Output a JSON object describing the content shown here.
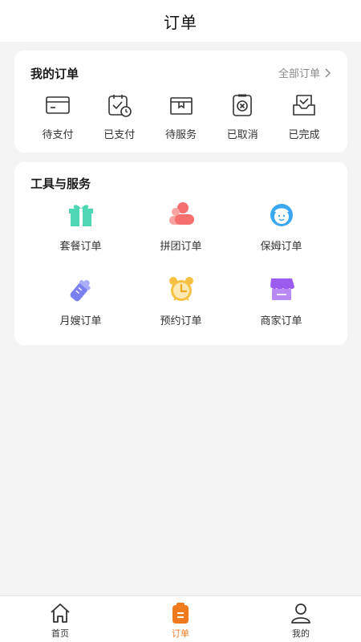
{
  "header": {
    "title": "订单"
  },
  "my_orders": {
    "title": "我的订单",
    "all_link": "全部订单",
    "items": [
      {
        "label": "待支付",
        "icon": "card-icon"
      },
      {
        "label": "已支付",
        "icon": "paid-clock-icon"
      },
      {
        "label": "待服务",
        "icon": "box-icon"
      },
      {
        "label": "已取消",
        "icon": "cancel-icon"
      },
      {
        "label": "已完成",
        "icon": "done-tray-icon"
      }
    ]
  },
  "tools": {
    "title": "工具与服务",
    "items": [
      {
        "label": "套餐订单",
        "icon": "gift-icon",
        "color": "#4fd6b4"
      },
      {
        "label": "拼团订单",
        "icon": "group-icon",
        "color": "#f56f6f"
      },
      {
        "label": "保姆订单",
        "icon": "nanny-icon",
        "color": "#3aa7f2"
      },
      {
        "label": "月嫂订单",
        "icon": "baby-bottle-icon",
        "color": "#7b80f0"
      },
      {
        "label": "预约订单",
        "icon": "alarm-clock-icon",
        "color": "#f6c043"
      },
      {
        "label": "商家订单",
        "icon": "shop-icon",
        "color": "#9b5bf0"
      }
    ]
  },
  "tabbar": {
    "items": [
      {
        "label": "首页",
        "icon": "home-icon"
      },
      {
        "label": "订单",
        "icon": "order-clipboard-icon",
        "active": true
      },
      {
        "label": "我的",
        "icon": "profile-icon"
      }
    ],
    "accent": "#f07a1e"
  }
}
